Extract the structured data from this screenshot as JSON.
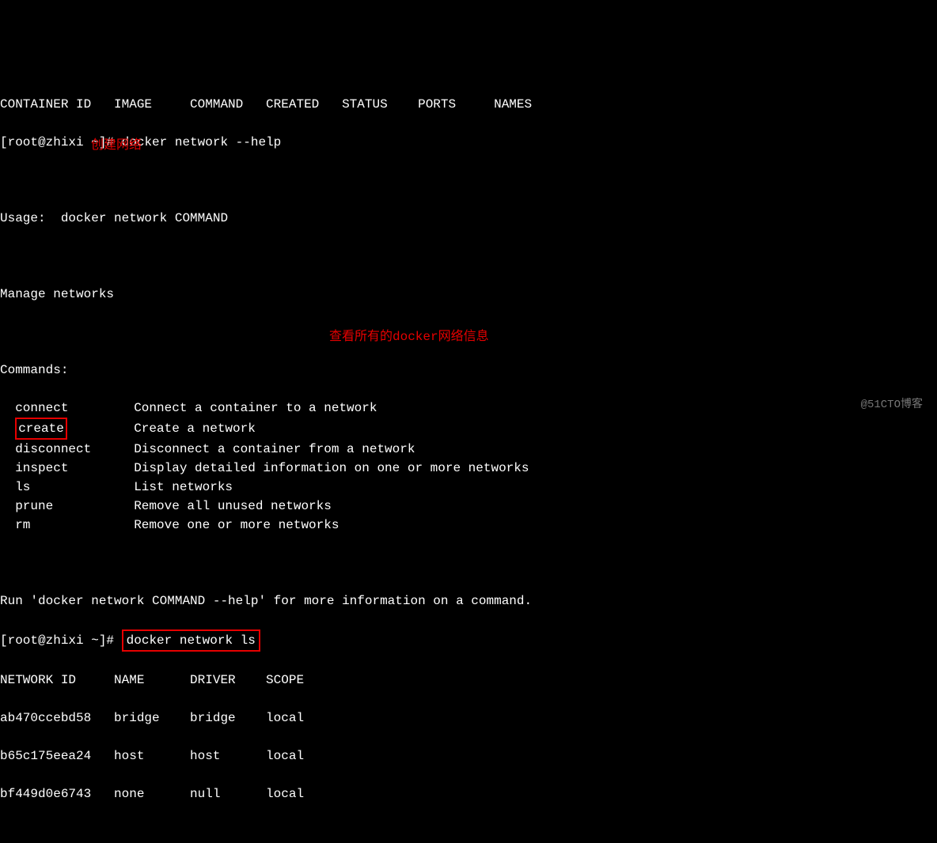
{
  "header": {
    "columns": "CONTAINER ID   IMAGE     COMMAND   CREATED   STATUS    PORTS     NAMES"
  },
  "prompt1": {
    "user_host": "[root@zhixi ~]#",
    "command": " docker network --help"
  },
  "usage": "Usage:  docker network COMMAND",
  "description": "Manage networks",
  "commands_label": "Commands:",
  "commands": {
    "connect": {
      "name": "  connect   ",
      "desc": "  Connect a container to a network"
    },
    "create": {
      "name": "create",
      "desc": "  Create a network"
    },
    "disconnect": {
      "name": "  disconnect",
      "desc": "  Disconnect a container from a network"
    },
    "inspect": {
      "name": "  inspect   ",
      "desc": "  Display detailed information on one or more networks"
    },
    "ls": {
      "name": "  ls        ",
      "desc": "  List networks"
    },
    "prune": {
      "name": "  prune     ",
      "desc": "  Remove all unused networks"
    },
    "rm": {
      "name": "  rm        ",
      "desc": "  Remove one or more networks"
    }
  },
  "footer_help": "Run 'docker network COMMAND --help' for more information on a command.",
  "prompt2": {
    "user_host": "[root@zhixi ~]#",
    "command": "docker network ls"
  },
  "network_table": {
    "header": "NETWORK ID     NAME      DRIVER    SCOPE",
    "rows": [
      "ab470ccebd58   bridge    bridge    local",
      "b65c175eea24   host      host      local",
      "bf449d0e6743   none      null      local"
    ]
  },
  "annotations": {
    "create": "创建网络",
    "ls": "查看所有的docker网络信息"
  },
  "watermark": "@51CTO博客"
}
